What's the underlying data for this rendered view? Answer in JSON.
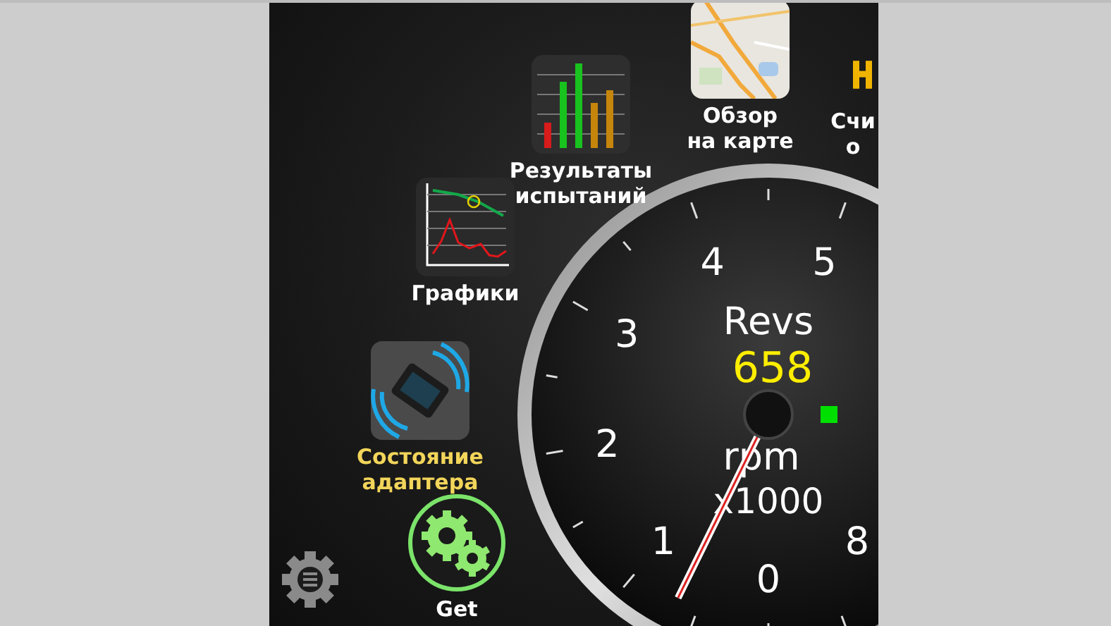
{
  "launcher": {
    "apps": [
      {
        "kind": "map",
        "label_lines": [
          "Обзор",
          "на карте"
        ],
        "highlighted": false
      },
      {
        "kind": "bar-chart",
        "label_lines": [
          "Результаты",
          "испытаний"
        ],
        "highlighted": false
      },
      {
        "kind": "line-chart",
        "label_lines": [
          "Графики"
        ],
        "highlighted": false
      },
      {
        "kind": "obd",
        "label_lines": [
          "Состояние",
          "адаптера"
        ],
        "highlighted": true
      },
      {
        "kind": "gears",
        "label_lines": [
          "Get"
        ],
        "highlighted": false
      },
      {
        "kind": "partial",
        "label_lines": [
          "Счи",
          "о"
        ],
        "highlighted": false
      }
    ]
  },
  "gauge": {
    "title": "Revs",
    "value": "658",
    "unit": "rpm",
    "multiplier": "x1000",
    "scale_labels": [
      "0",
      "1",
      "2",
      "3",
      "4",
      "5",
      "8"
    ],
    "level": 0.082,
    "status_on": true
  }
}
